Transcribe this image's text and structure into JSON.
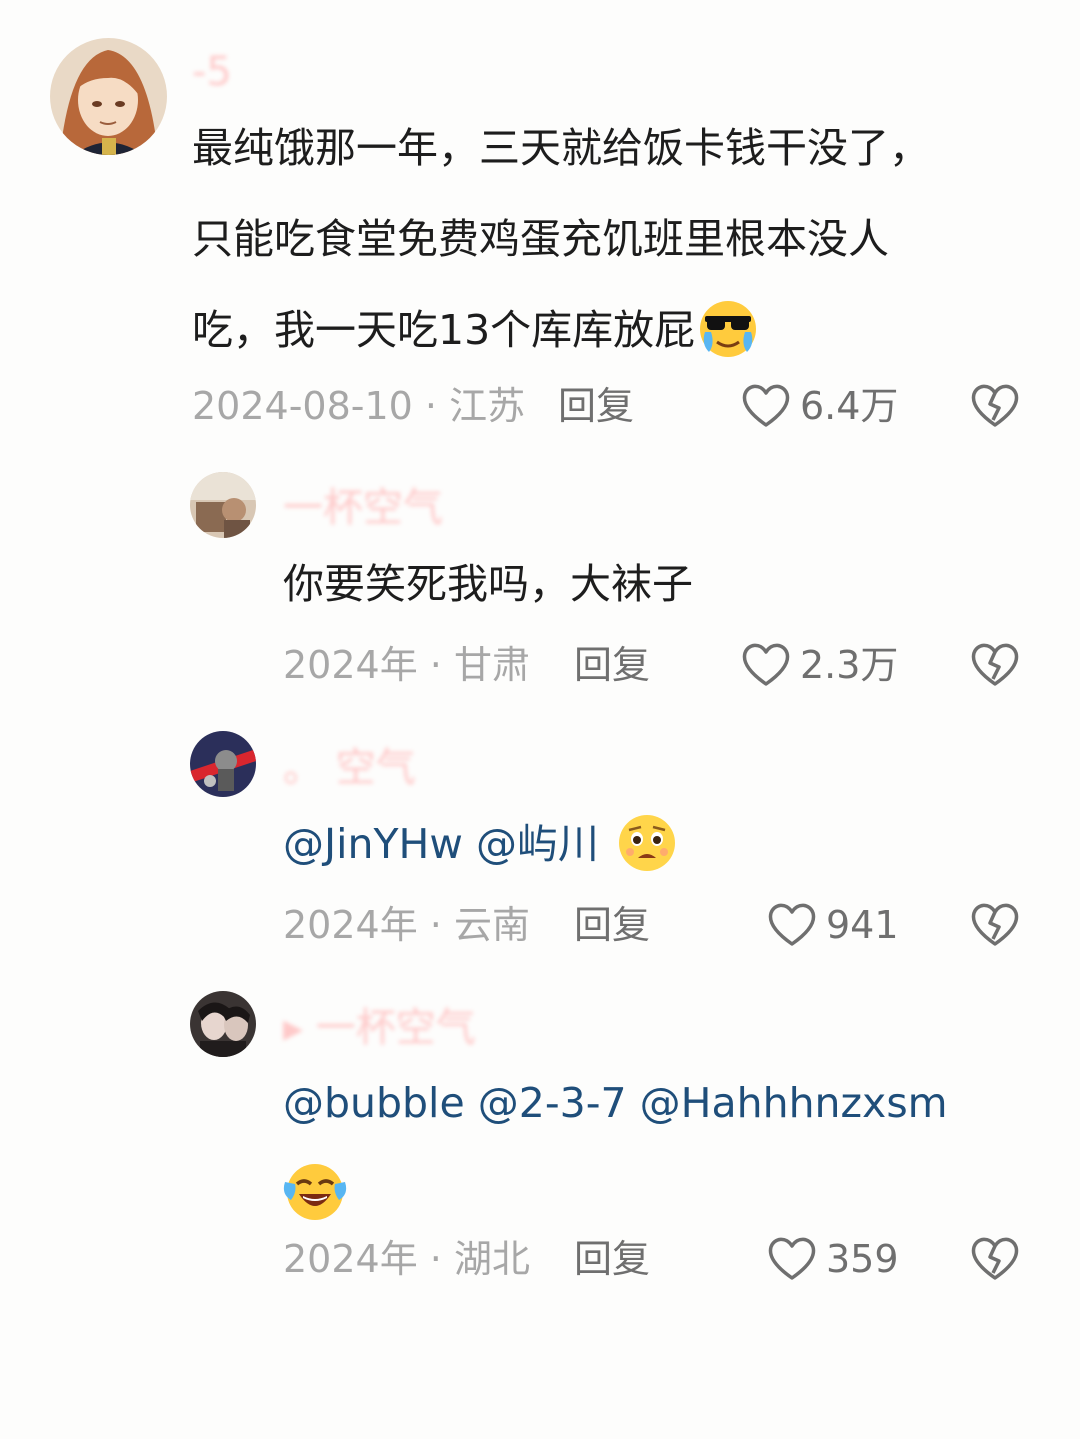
{
  "colors": {
    "background": "#fdfdfc",
    "text": "#1d1d1d",
    "meta": "#a7a7a7",
    "action": "#6f6f6f",
    "mention": "#1f4e7a",
    "username_faded": "#ffb8b8"
  },
  "comments": [
    {
      "username": "-5",
      "body_lines": [
        "最纯饿那一年，三天就给饭卡钱干没了，",
        "只能吃食堂免费鸡蛋充饥班里根本没人",
        "吃，我一天吃13个库库放屁"
      ],
      "emoji": "cool-crying-emoji",
      "date_location": "2024-08-10 · 江苏",
      "reply_label": "回复",
      "likes": "6.4万"
    },
    {
      "username": "一杯空气",
      "body_lines": [
        "你要笑死我吗，大袜子"
      ],
      "date_location": "2024年 · 甘肃",
      "reply_label": "回复",
      "likes": "2.3万"
    },
    {
      "username": "。  空气",
      "mentions": [
        "@JinYHw",
        "@屿川"
      ],
      "emoji": "pleading-emoji",
      "date_location": "2024年 · 云南",
      "reply_label": "回复",
      "likes": "941"
    },
    {
      "username": "▸ 一杯空气",
      "mentions": [
        "@bubble",
        "@2-3-7",
        "@Hahhhnzxsm"
      ],
      "emoji": "laughing-crying-emoji",
      "date_location": "2024年 · 湖北",
      "reply_label": "回复",
      "likes": "359"
    }
  ]
}
